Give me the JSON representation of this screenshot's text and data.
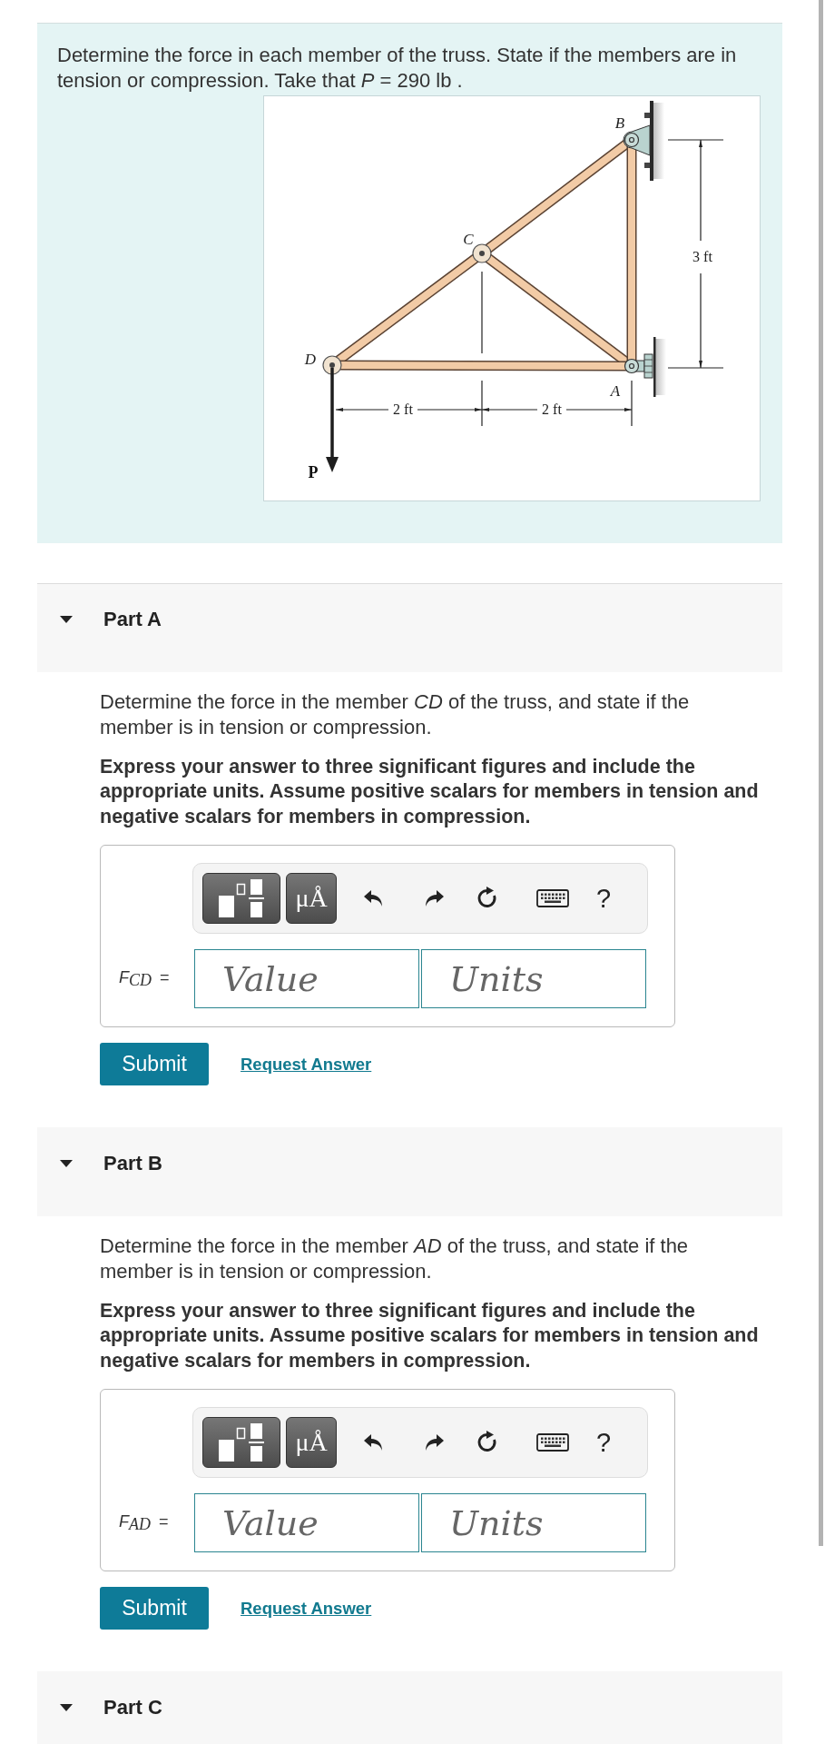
{
  "problem": {
    "text": "Determine the force in each member of the truss. State if the members are in tension or compression. Take that *P* = 290 lb .",
    "figure": {
      "joint_labels": [
        "B",
        "C",
        "D",
        "A"
      ],
      "height_dimension": "3 ft",
      "span_dimensions": [
        "2 ft",
        "2 ft"
      ],
      "load_label": "P"
    }
  },
  "parts": [
    {
      "title": "Part A",
      "expanded": true,
      "question": "Determine the force in the member *CD* of the truss, and state if the member is in tension or compression.",
      "instructions": "Express your answer to three significant figures and include the appropriate units. Assume positive scalars for members in tension and negative scalars for members in compression.",
      "answer": {
        "label": "*F*$_{CD}$ =",
        "units_button": "μÅ",
        "help": "?",
        "value_placeholder": "Value",
        "units_placeholder": "Units"
      },
      "submit": "Submit",
      "request_answer": "Request Answer"
    },
    {
      "title": "Part B",
      "expanded": true,
      "question": "Determine the force in the member *AD* of the truss, and state if the member is in tension or compression.",
      "instructions": "Express your answer to three significant figures and include the appropriate units. Assume positive scalars for members in tension and negative scalars for members in compression.",
      "answer": {
        "label": "*F*$_{AD}$ =",
        "units_button": "μÅ",
        "help": "?",
        "value_placeholder": "Value",
        "units_placeholder": "Units"
      },
      "submit": "Submit",
      "request_answer": "Request Answer"
    },
    {
      "title": "Part C",
      "expanded": true
    }
  ]
}
